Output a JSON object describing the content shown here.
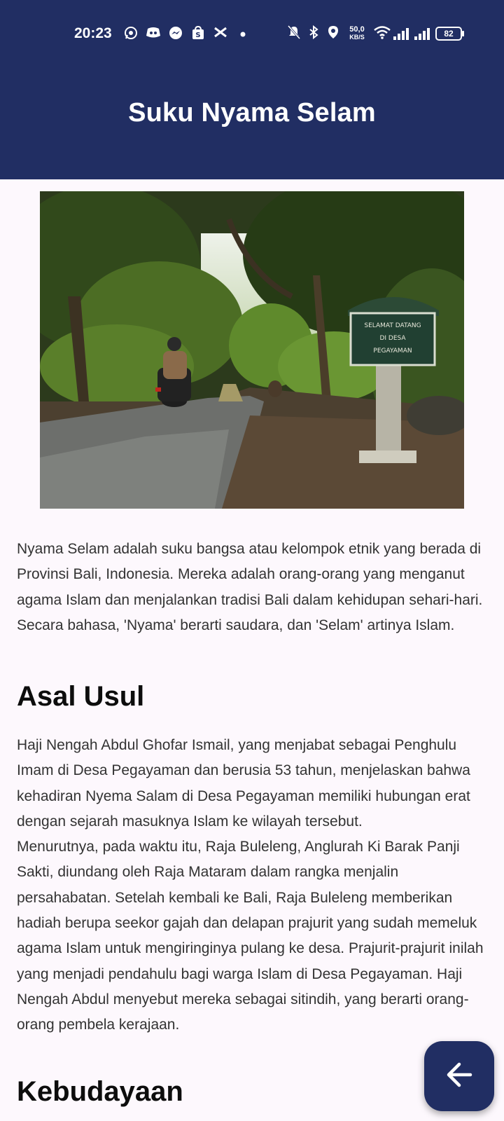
{
  "status_bar": {
    "time": "20:23",
    "net_speed_value": "50,0",
    "net_speed_unit": "KB/S",
    "battery": "82"
  },
  "app_bar": {
    "title": "Suku Nyama Selam"
  },
  "photo": {
    "sign_line1": "SELAMAT DATANG",
    "sign_line2": "DI DESA",
    "sign_line3": "PEGAYAMAN"
  },
  "article": {
    "intro": "Nyama Selam adalah suku bangsa atau kelompok etnik yang berada di Provinsi Bali, Indonesia. Mereka adalah orang-orang yang menganut agama Islam dan menjalankan tradisi Bali dalam kehidupan sehari-hari. Secara bahasa, 'Nyama' berarti saudara, dan 'Selam' artinya Islam.",
    "section1_heading": "Asal Usul",
    "section1_p1": "Haji Nengah Abdul Ghofar Ismail, yang menjabat sebagai Penghulu Imam di Desa Pegayaman dan berusia 53 tahun, menjelaskan bahwa kehadiran Nyema Salam di Desa Pegayaman memiliki hubungan erat dengan sejarah masuknya Islam ke wilayah tersebut.",
    "section1_p2": "Menurutnya, pada waktu itu, Raja Buleleng, Anglurah Ki Barak Panji Sakti, diundang oleh Raja Mataram dalam rangka menjalin persahabatan. Setelah kembali ke Bali, Raja Buleleng memberikan hadiah berupa seekor gajah dan delapan prajurit yang sudah memeluk agama Islam untuk mengiringinya pulang ke desa. Prajurit-prajurit inilah yang menjadi pendahulu bagi warga Islam di Desa Pegayaman. Haji Nengah Abdul menyebut mereka sebagai sitindih, yang berarti orang-orang pembela kerajaan.",
    "section2_heading": "Kebudayaan"
  },
  "icons": {
    "back_fab": "arrow-left-icon"
  }
}
